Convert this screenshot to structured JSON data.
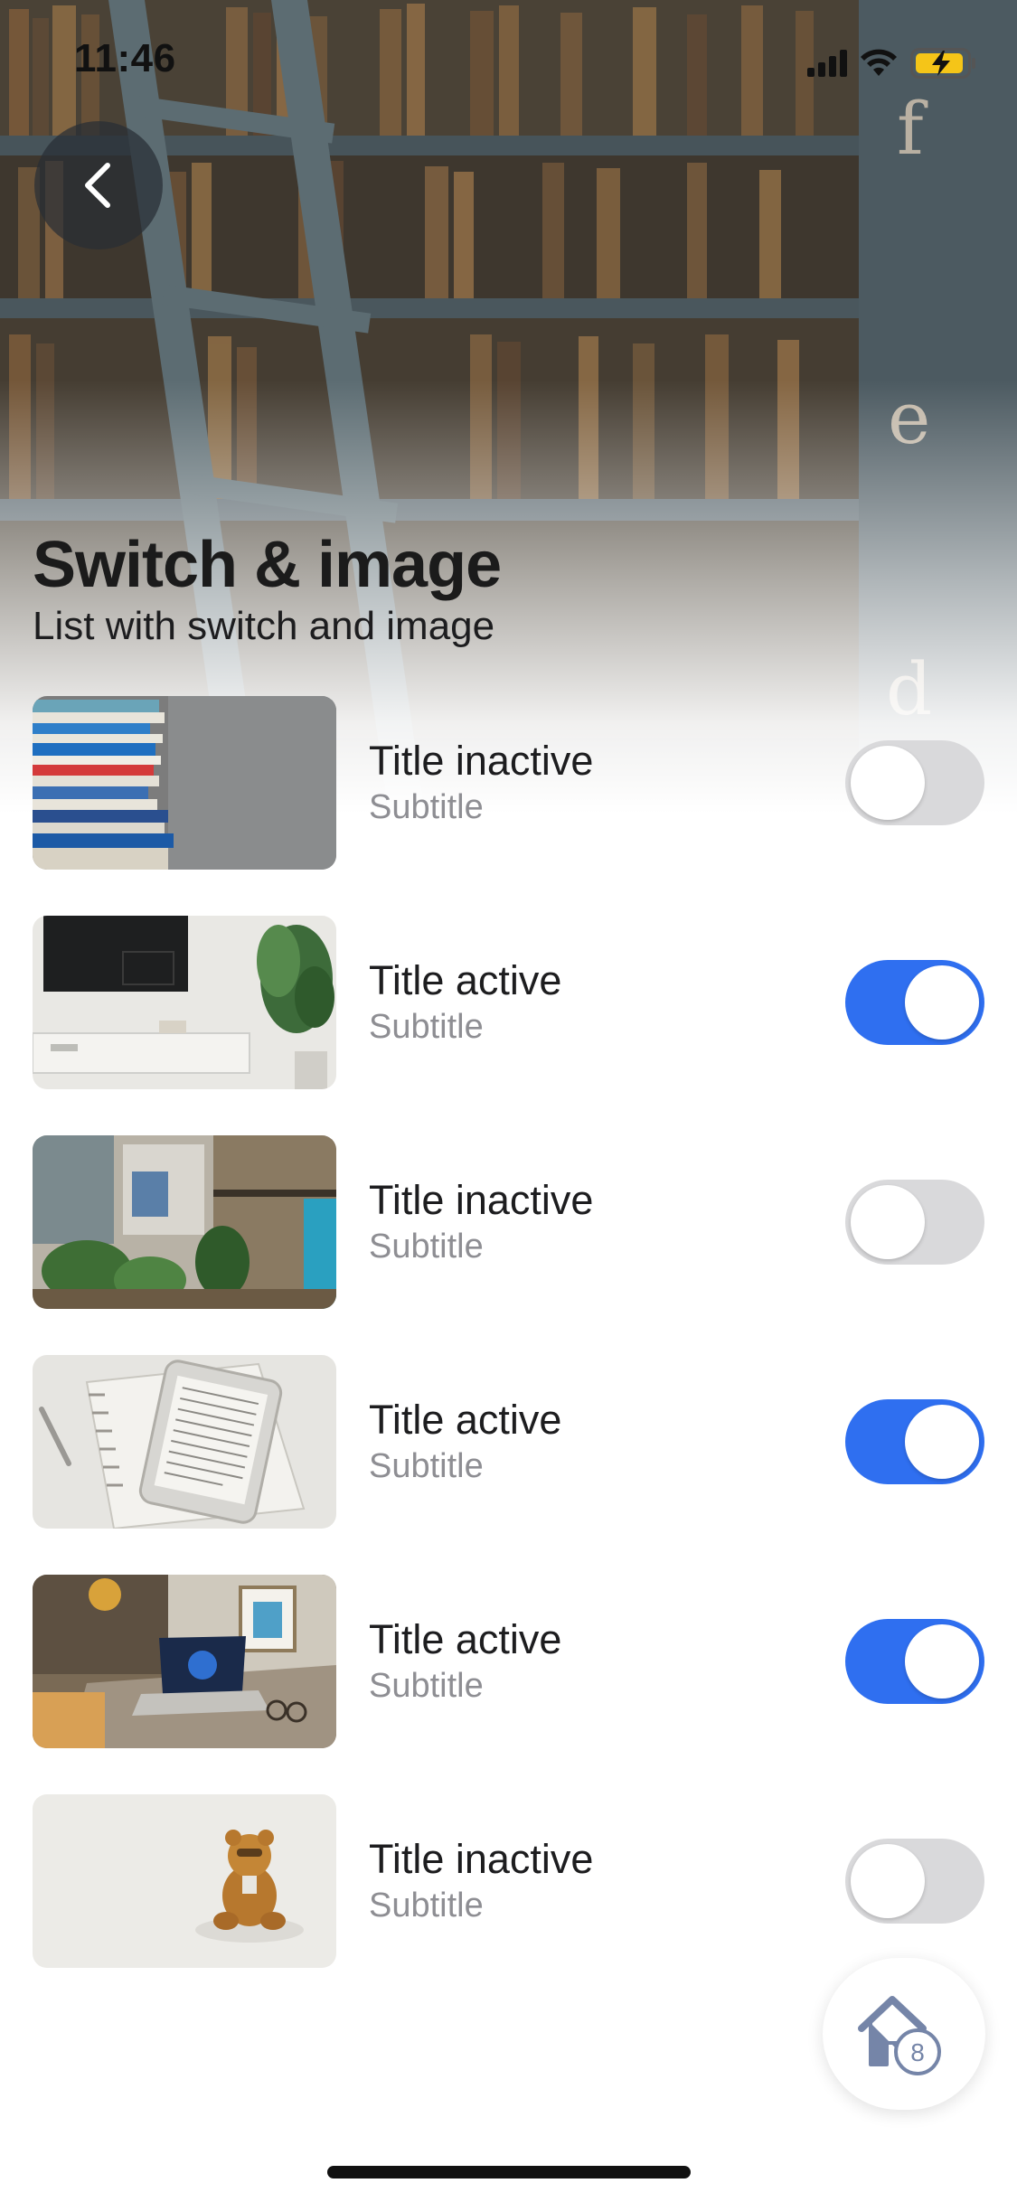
{
  "status_bar": {
    "time": "11:46"
  },
  "header": {
    "title": "Switch & image",
    "subtitle": "List with switch and image",
    "wall_letters": [
      "f",
      "e",
      "d"
    ]
  },
  "list": {
    "items": [
      {
        "title": "Title inactive",
        "subtitle": "Subtitle",
        "active": false,
        "image": "stacked-books"
      },
      {
        "title": "Title active",
        "subtitle": "Subtitle",
        "active": true,
        "image": "living-room-tv"
      },
      {
        "title": "Title inactive",
        "subtitle": "Subtitle",
        "active": false,
        "image": "cafe-plants"
      },
      {
        "title": "Title active",
        "subtitle": "Subtitle",
        "active": true,
        "image": "ereader-notebook"
      },
      {
        "title": "Title active",
        "subtitle": "Subtitle",
        "active": true,
        "image": "desk-laptop"
      },
      {
        "title": "Title inactive",
        "subtitle": "Subtitle",
        "active": false,
        "image": "teddy-bear"
      }
    ]
  },
  "fab": {
    "badge": "8",
    "icon": "home-icon"
  },
  "colors": {
    "switch_on": "#2f6ff0",
    "switch_off": "#d9d9db",
    "subtitle": "#8e8e93"
  }
}
